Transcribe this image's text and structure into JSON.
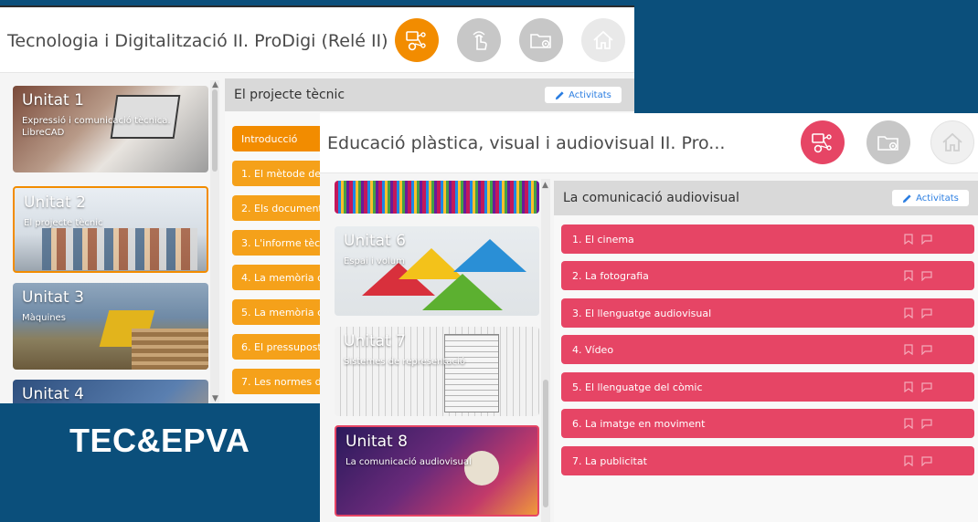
{
  "badge": "TEC&EPVA",
  "tec": {
    "title": "Tecnologia i Digitalització II. ProDigi (Relé II)",
    "accent": "#f28c00",
    "units": [
      {
        "name": "Unitat 1",
        "subtitle": "Expressió i comunicació tècnica. LibreCAD"
      },
      {
        "name": "Unitat 2",
        "subtitle": "El projecte tècnic"
      },
      {
        "name": "Unitat 3",
        "subtitle": "Màquines"
      },
      {
        "name": "Unitat 4",
        "subtitle": ""
      }
    ],
    "panel": {
      "title": "El projecte tècnic",
      "activities_label": "Activitats",
      "topics": [
        "Introducció",
        "1. El mètode de",
        "2. Els document",
        "3. L'informe tèc",
        "4. La memòria d",
        "5. La memòria c",
        "6. El pressupost",
        "7. Les normes d"
      ]
    }
  },
  "epva": {
    "title": "Educació plàstica, visual i audiovisual II. Pro...",
    "accent": "#e64565",
    "units": [
      {
        "name": "Unitat 6",
        "subtitle": "Espai i volum"
      },
      {
        "name": "Unitat 7",
        "subtitle": "Sistemes de representació"
      },
      {
        "name": "Unitat 8",
        "subtitle": "La comunicació audiovisual"
      }
    ],
    "panel": {
      "title": "La comunicació audiovisual",
      "activities_label": "Activitats",
      "topics": [
        "1. El cinema",
        "2. La fotografia",
        "3. El llenguatge audiovisual",
        "4. Vídeo",
        "5. El llenguatge del còmic",
        "6. La imatge en moviment",
        "7. La publicitat"
      ]
    }
  }
}
